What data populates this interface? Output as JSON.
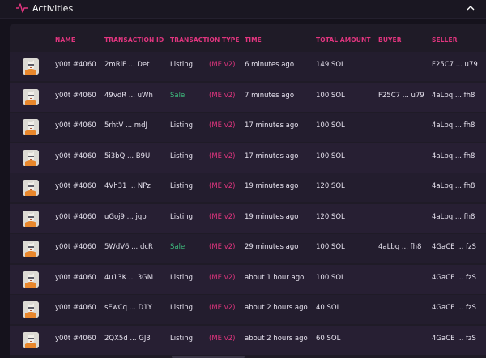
{
  "header": {
    "title": "Activities"
  },
  "columns": [
    "NAME",
    "TRANSACTION ID",
    "TRANSACTION TYPE",
    "TIME",
    "TOTAL AMOUNT",
    "BUYER",
    "SELLER"
  ],
  "rows": [
    {
      "name": "y00t #4060",
      "txid": "2mRiF ... Det",
      "type": "Listing",
      "market": "(ME v2)",
      "time": "6 minutes ago",
      "amount": "149 SOL",
      "buyer": "",
      "seller": "F25C7 ... u79"
    },
    {
      "name": "y00t #4060",
      "txid": "49vdR ... uWh",
      "type": "Sale",
      "market": "(ME v2)",
      "time": "7 minutes ago",
      "amount": "100 SOL",
      "buyer": "F25C7 ... u79",
      "seller": "4aLbq ... fh8"
    },
    {
      "name": "y00t #4060",
      "txid": "5rhtV ... mdJ",
      "type": "Listing",
      "market": "(ME v2)",
      "time": "17 minutes ago",
      "amount": "100 SOL",
      "buyer": "",
      "seller": "4aLbq ... fh8"
    },
    {
      "name": "y00t #4060",
      "txid": "5i3bQ ... B9U",
      "type": "Listing",
      "market": "(ME v2)",
      "time": "17 minutes ago",
      "amount": "100 SOL",
      "buyer": "",
      "seller": "4aLbq ... fh8"
    },
    {
      "name": "y00t #4060",
      "txid": "4Vh31 ... NPz",
      "type": "Listing",
      "market": "(ME v2)",
      "time": "19 minutes ago",
      "amount": "120 SOL",
      "buyer": "",
      "seller": "4aLbq ... fh8"
    },
    {
      "name": "y00t #4060",
      "txid": "uGoj9 ... jqp",
      "type": "Listing",
      "market": "(ME v2)",
      "time": "19 minutes ago",
      "amount": "120 SOL",
      "buyer": "",
      "seller": "4aLbq ... fh8"
    },
    {
      "name": "y00t #4060",
      "txid": "5WdV6 ... dcR",
      "type": "Sale",
      "market": "(ME v2)",
      "time": "29 minutes ago",
      "amount": "100 SOL",
      "buyer": "4aLbq ... fh8",
      "seller": "4GaCE ... fzS"
    },
    {
      "name": "y00t #4060",
      "txid": "4u13K ... 3GM",
      "type": "Listing",
      "market": "(ME v2)",
      "time": "about 1 hour ago",
      "amount": "100 SOL",
      "buyer": "",
      "seller": "4GaCE ... fzS"
    },
    {
      "name": "y00t #4060",
      "txid": "sEwCq ... D1Y",
      "type": "Listing",
      "market": "(ME v2)",
      "time": "about 2 hours ago",
      "amount": "40 SOL",
      "buyer": "",
      "seller": "4GaCE ... fzS"
    },
    {
      "name": "y00t #4060",
      "txid": "2QX5d ... GJ3",
      "type": "Listing",
      "market": "(ME v2)",
      "time": "about 2 hours ago",
      "amount": "60 SOL",
      "buyer": "",
      "seller": "4GaCE ... fzS"
    }
  ],
  "colors": {
    "accent": "#e2357f",
    "sale": "#3fbf7f"
  },
  "icons": {
    "header": "activity-pulse-icon",
    "collapse": "chevron-up-icon"
  }
}
